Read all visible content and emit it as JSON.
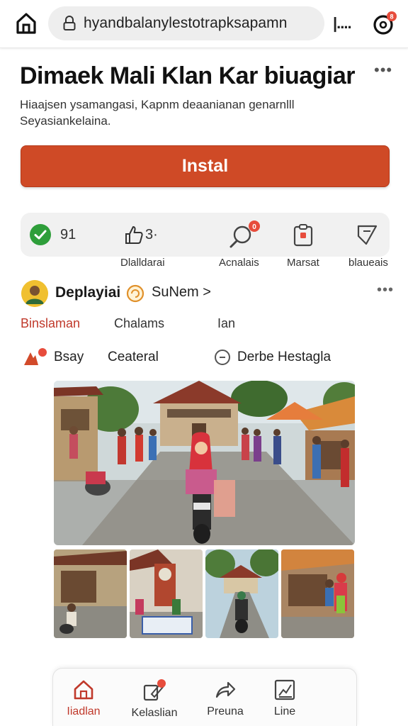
{
  "browser": {
    "url": "hyandbalanylestotrapksapamn",
    "more_label": "|...."
  },
  "app": {
    "title": "Dimaek Mali Klan Kar biuagiar",
    "description": "Hiaajsen ysamangasi, Kapnm deaanianan genarnlll Seyasiankelaina.",
    "install_label": "Instal"
  },
  "stats": [
    {
      "icon": "check-circle-icon",
      "value": "91",
      "label": ""
    },
    {
      "icon": "thumb-up-icon",
      "value": "3·",
      "label": "Dlalldarai"
    },
    {
      "icon": "search-badge-icon",
      "value": "",
      "label": "Acnalais"
    },
    {
      "icon": "clipboard-icon",
      "value": "",
      "label": "Marsat"
    },
    {
      "icon": "tag-icon",
      "value": "",
      "label": "blaueais"
    }
  ],
  "publisher": {
    "name": "Deplayiai",
    "subscribe_label": "SuNem >"
  },
  "tabs": [
    "Binslaman",
    "Chalams",
    "Ian"
  ],
  "meta": {
    "category_label": "Bsay",
    "type_label": "Ceateral",
    "extra_label": "Derbe Hestagla"
  },
  "bottom_nav": [
    {
      "icon": "home-icon",
      "label": "Iiadlan",
      "active": true
    },
    {
      "icon": "edit-badge-icon",
      "label": "Kelaslian",
      "active": false
    },
    {
      "icon": "share-arrow-icon",
      "label": "Preuna",
      "active": false
    },
    {
      "icon": "chart-icon",
      "label": "Line",
      "active": false
    }
  ],
  "colors": {
    "accent": "#cf4a26",
    "active_text": "#c0392b",
    "badge": "#e74c3c",
    "check": "#2e9e3a"
  }
}
